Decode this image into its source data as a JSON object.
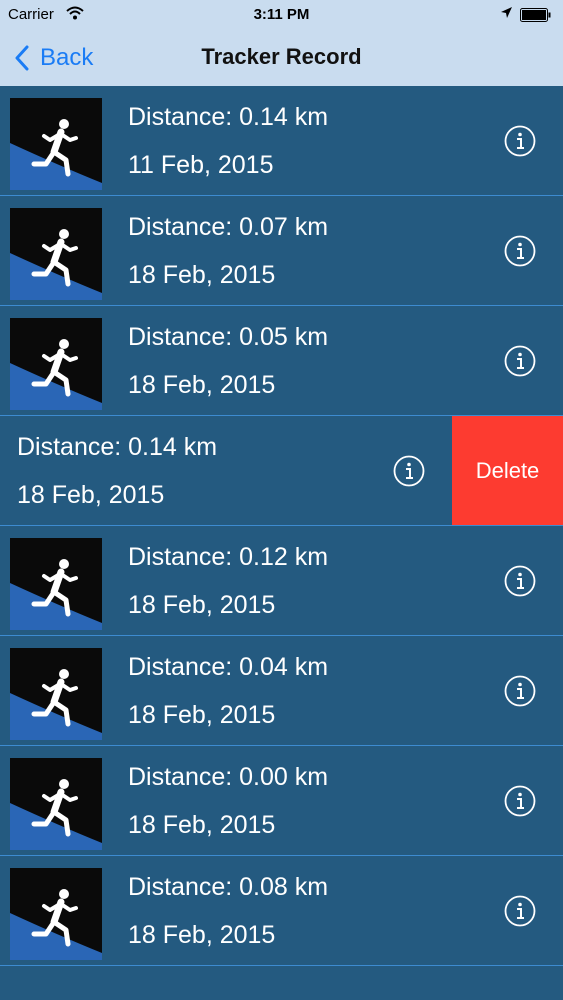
{
  "status": {
    "carrier": "Carrier",
    "time": "3:11 PM"
  },
  "nav": {
    "back_label": "Back",
    "title": "Tracker Record"
  },
  "records": [
    {
      "distance": "Distance: 0.14 km",
      "date": "11 Feb, 2015"
    },
    {
      "distance": "Distance: 0.07 km",
      "date": "18 Feb, 2015"
    },
    {
      "distance": "Distance: 0.05 km",
      "date": "18 Feb, 2015"
    },
    {
      "distance": "Distance: 0.14 km",
      "date": "18 Feb, 2015",
      "swiped": true,
      "delete_label": "Delete"
    },
    {
      "distance": "Distance: 0.12 km",
      "date": "18 Feb, 2015"
    },
    {
      "distance": "Distance: 0.04 km",
      "date": "18 Feb, 2015"
    },
    {
      "distance": "Distance: 0.00 km",
      "date": "18 Feb, 2015"
    },
    {
      "distance": "Distance: 0.08 km",
      "date": "18 Feb, 2015"
    }
  ],
  "colors": {
    "list_background": "#245a80",
    "nav_background": "#c9dcef",
    "accent": "#1a7cf5",
    "delete": "#fd3b30"
  },
  "icons": {
    "record_thumbnail": "runner-icon",
    "row_accessory": "info-icon",
    "back": "chevron-left-icon"
  }
}
